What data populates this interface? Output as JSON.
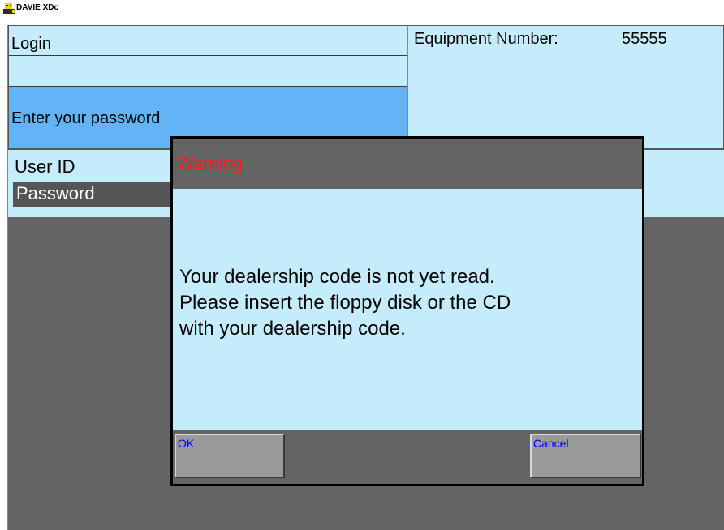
{
  "window": {
    "title": "DAVIE XDc",
    "icon": "davie-app-icon"
  },
  "header": {
    "login_title": "Login",
    "prompt": "Enter your password",
    "equipment_label": "Equipment Number:",
    "equipment_value": "55555"
  },
  "fields": {
    "user_id_label": "User ID",
    "password_label": "Password"
  },
  "dialog": {
    "title": "Warning",
    "message_lines": [
      "Your dealership code is not yet read.",
      "Please insert the floppy disk or the CD",
      "with your dealership code."
    ],
    "ok_label": "OK",
    "cancel_label": "Cancel"
  },
  "colors": {
    "panel": "#c4ecfb",
    "prompt_bar": "#62b4f6",
    "background": "#646464",
    "warning_title": "#ff1a1a",
    "button_text": "#0000ff"
  }
}
